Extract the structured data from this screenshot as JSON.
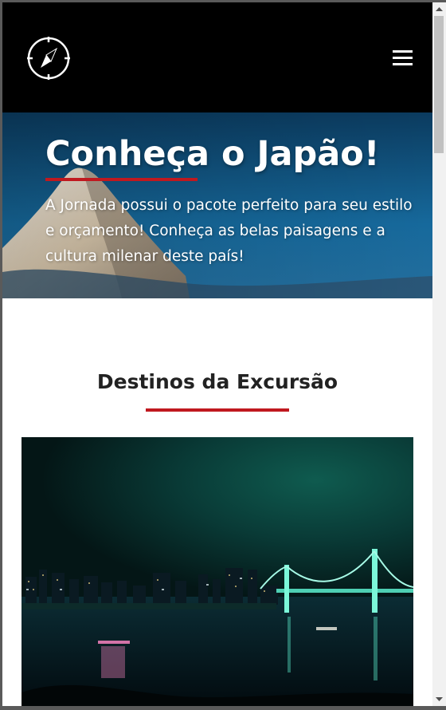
{
  "header": {
    "logo_icon": "compass-icon",
    "menu_icon": "hamburger-menu-icon",
    "background": "#000000"
  },
  "hero": {
    "title": "Conheça o Japão!",
    "text": "A Jornada possui o pacote perfeito para seu estilo e orçamento! Conheça as belas paisagens e a cultura milenar deste país!",
    "image": "mount-fuji-photo"
  },
  "section": {
    "title": "Destinos da Excursão",
    "image": "tokyo-rainbow-bridge-night-photo"
  },
  "colors": {
    "accent": "#c0191f",
    "heading": "#222222",
    "header_bg": "#000000"
  },
  "scrollbar": {
    "up_icon": "arrow-up-icon",
    "down_icon": "arrow-down-icon"
  }
}
